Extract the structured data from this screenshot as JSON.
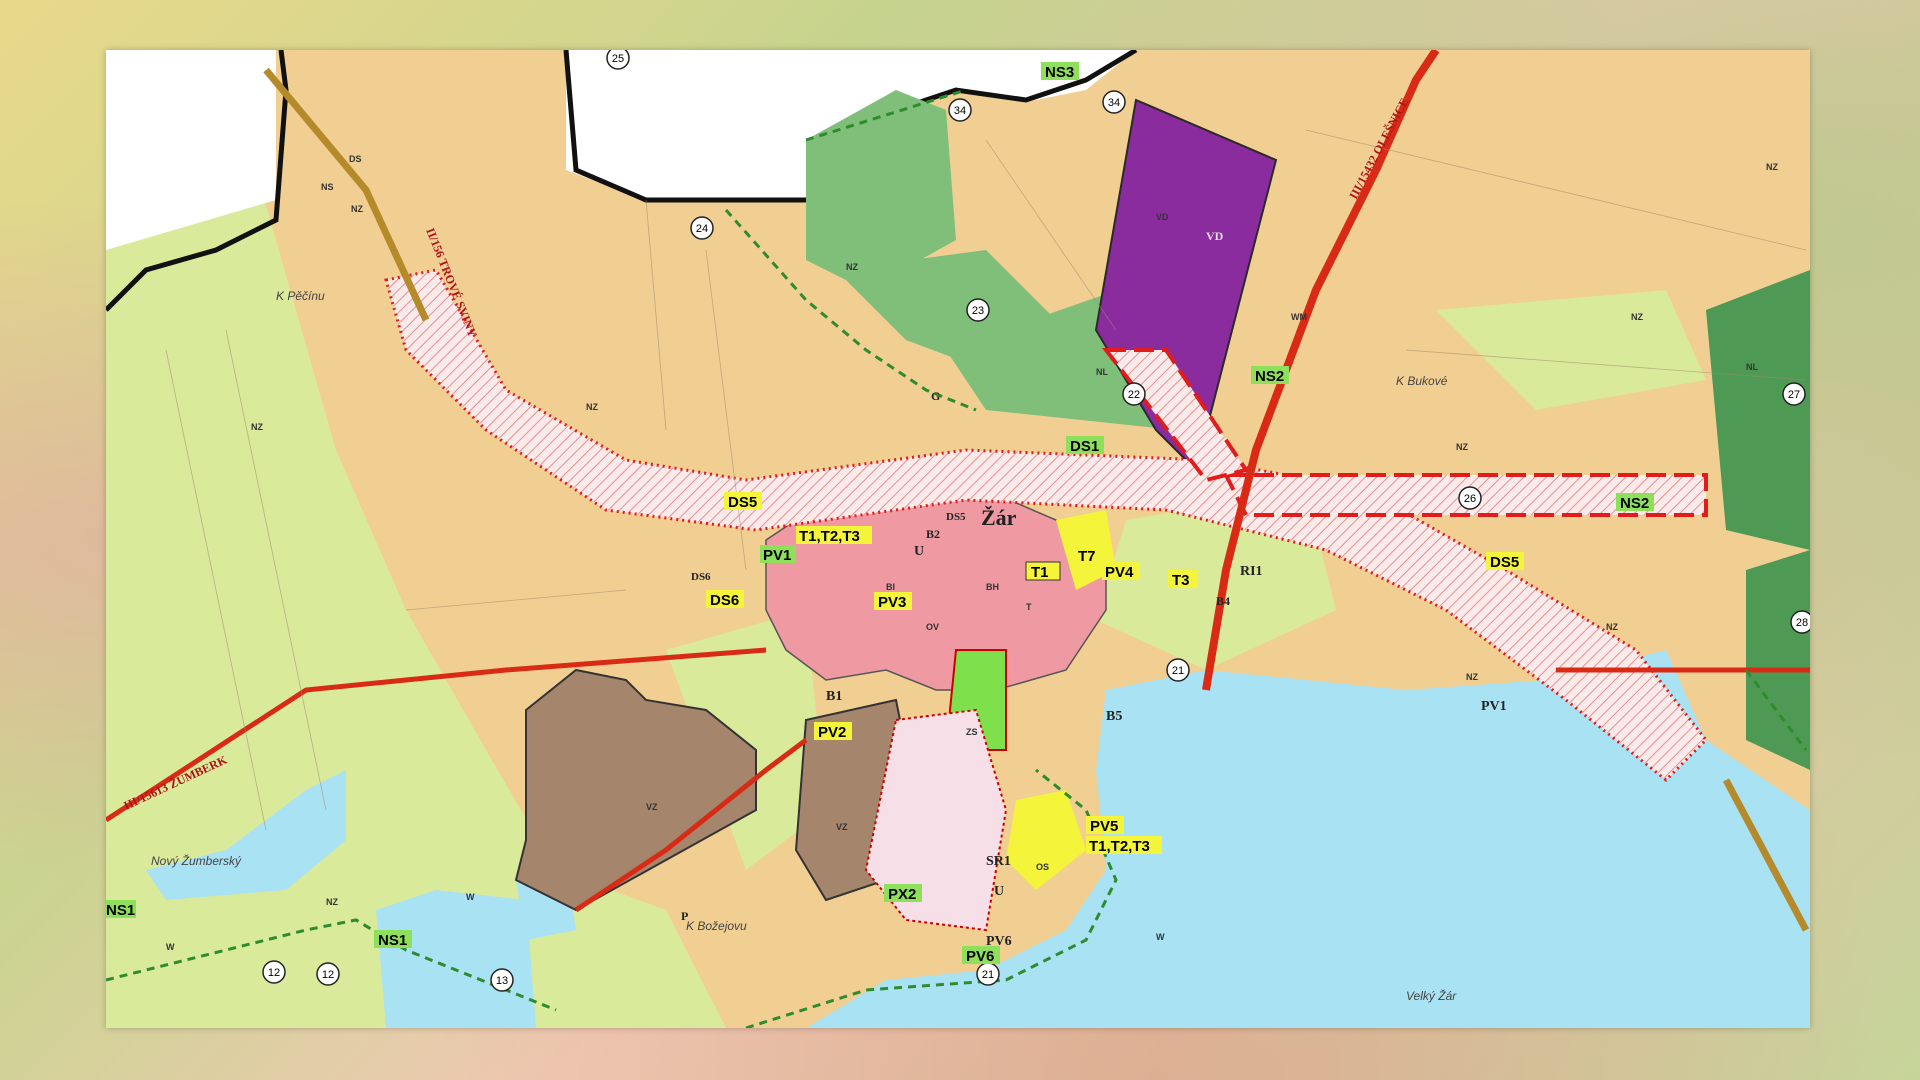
{
  "colors": {
    "agri": "#f1cf92",
    "meadow": "#d9ea9b",
    "forest": "#7fbf7a",
    "forest_dark": "#4e9a55",
    "water": "#a9e2f3",
    "residential": "#ef9aa3",
    "industrial": "#a5856b",
    "production_purple": "#8b2c9e",
    "road": "#d92a16",
    "corridor": "#e21b1b",
    "yellow_tag": "#f4f43a",
    "green_tag": "#8ee05b"
  },
  "place": {
    "name": "Žár"
  },
  "roads": {
    "r1": "II/156 TROVÉ SVINY",
    "r2": "III/15613 ŽUMBERK",
    "r3": "III/15432 OLEŠNICE"
  },
  "localities": {
    "k_pocinu": "K Pěčínu",
    "k_bukove": "K Bukové",
    "k_bozejovu": "K Božejovu",
    "novy_zumbersky": "Nový Žumberský",
    "velky_zar": "Velký Žár"
  },
  "tags": {
    "ns1a": "NS1",
    "ns1b": "NS1",
    "ns2a": "NS2",
    "ns2b": "NS2",
    "ns3": "NS3",
    "ds1": "DS1",
    "ds5a": "DS5",
    "ds5b": "DS5",
    "ds5c": "DS5",
    "ds6a": "DS6",
    "ds6b": "DS6",
    "pv1a": "PV1",
    "pv1b": "PV1",
    "pv2": "PV2",
    "pv3": "PV3",
    "pv4": "PV4",
    "pv5": "PV5",
    "pv6a": "PV6",
    "pv6b": "PV6",
    "px2": "PX2",
    "t1a": "T1",
    "t3": "T3",
    "t7": "T7",
    "t123a": "T1,T2,T3",
    "t123b": "T1,T2,T3",
    "b1": "B1",
    "b2": "B2",
    "b4": "B4",
    "b5": "B5",
    "ri1": "RI1",
    "vd": "VD",
    "sr1": "SR1",
    "u1": "U",
    "u2": "U",
    "p": "P",
    "g": "G"
  },
  "land_use_codes": {
    "nz": "NZ",
    "ns": "NS",
    "nl": "NL",
    "ds": "DS",
    "w": "W",
    "vz": "VZ",
    "vd": "VD",
    "wm": "WM",
    "zs": "ZS",
    "os": "OS",
    "bi": "BI",
    "bh": "BH",
    "ov": "OV",
    "t": "T"
  },
  "circle_numbers": [
    "25",
    "34",
    "34",
    "24",
    "23",
    "22",
    "26",
    "27",
    "28",
    "21",
    "21",
    "12",
    "12",
    "13"
  ]
}
